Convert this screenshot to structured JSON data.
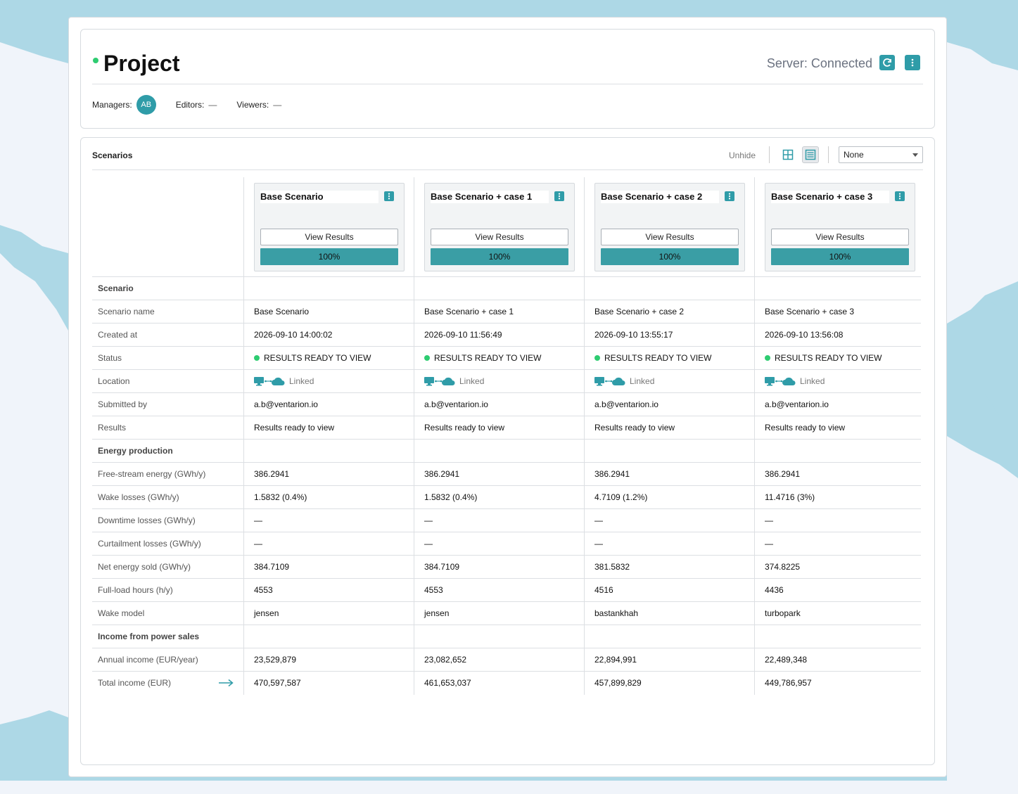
{
  "project": {
    "title": "Project",
    "server_status": "Server: Connected",
    "managers_label": "Managers:",
    "manager_initials": "AB",
    "editors_label": "Editors:",
    "editors_value": "—",
    "viewers_label": "Viewers:",
    "viewers_value": "—"
  },
  "scenarios_panel": {
    "title": "Scenarios",
    "unhide_label": "Unhide",
    "sort_select_value": "None"
  },
  "scenario_cards": [
    {
      "name": "Base Scenario",
      "button_label": "View Results",
      "progress_label": "100%",
      "progress": 1.0
    },
    {
      "name": "Base Scenario + case 1",
      "button_label": "View Results",
      "progress_label": "100%",
      "progress": 1.0
    },
    {
      "name": "Base Scenario + case 2",
      "button_label": "View Results",
      "progress_label": "100%",
      "progress": 1.0
    },
    {
      "name": "Base Scenario + case 3",
      "button_label": "View Results",
      "progress_label": "100%",
      "progress": 1.0
    }
  ],
  "rows": [
    {
      "label": "Scenario",
      "section": true,
      "values": [
        "",
        "",
        "",
        ""
      ]
    },
    {
      "label": "Scenario name",
      "values": [
        "Base Scenario",
        "Base Scenario + case 1",
        "Base Scenario + case 2",
        "Base Scenario + case 3"
      ]
    },
    {
      "label": "Created at",
      "values": [
        "2026-09-10 14:00:02",
        "2026-09-10 11:56:49",
        "2026-09-10 13:55:17",
        "2026-09-10 13:56:08"
      ]
    },
    {
      "label": "Status",
      "type": "status",
      "values": [
        "RESULTS READY TO VIEW",
        "RESULTS READY TO VIEW",
        "RESULTS READY TO VIEW",
        "RESULTS READY TO VIEW"
      ]
    },
    {
      "label": "Location",
      "type": "location",
      "values": [
        "Linked",
        "Linked",
        "Linked",
        "Linked"
      ]
    },
    {
      "label": "Submitted by",
      "values": [
        "a.b@ventarion.io",
        "a.b@ventarion.io",
        "a.b@ventarion.io",
        "a.b@ventarion.io"
      ]
    },
    {
      "label": "Results",
      "values": [
        "Results ready to view",
        "Results ready to view",
        "Results ready to view",
        "Results ready to view"
      ]
    },
    {
      "label": "Energy production",
      "section": true,
      "values": [
        "",
        "",
        "",
        ""
      ]
    },
    {
      "label": "Free-stream energy (GWh/y)",
      "values": [
        "386.2941",
        "386.2941",
        "386.2941",
        "386.2941"
      ]
    },
    {
      "label": "Wake losses (GWh/y)",
      "values": [
        "1.5832 (0.4%)",
        "1.5832 (0.4%)",
        "4.7109 (1.2%)",
        "11.4716 (3%)"
      ]
    },
    {
      "label": "Downtime losses (GWh/y)",
      "values": [
        "—",
        "—",
        "—",
        "—"
      ]
    },
    {
      "label": "Curtailment losses (GWh/y)",
      "values": [
        "—",
        "—",
        "—",
        "—"
      ]
    },
    {
      "label": "Net energy sold (GWh/y)",
      "values": [
        "384.7109",
        "384.7109",
        "381.5832",
        "374.8225"
      ]
    },
    {
      "label": "Full-load hours (h/y)",
      "values": [
        "4553",
        "4553",
        "4516",
        "4436"
      ]
    },
    {
      "label": "Wake model",
      "values": [
        "jensen",
        "jensen",
        "bastankhah",
        "turbopark"
      ]
    },
    {
      "label": "Income from power sales",
      "section": true,
      "values": [
        "",
        "",
        "",
        ""
      ]
    },
    {
      "label": "Annual income (EUR/year)",
      "values": [
        "23,529,879",
        "23,082,652",
        "22,894,991",
        "22,489,348"
      ]
    },
    {
      "label": "Total income (EUR)",
      "type": "total",
      "values": [
        "470,597,587",
        "461,653,037",
        "457,899,829",
        "449,786,957"
      ]
    }
  ],
  "colors": {
    "accent": "#2f9ca8",
    "progress_fill": "#3a9ea5",
    "status_green": "#2ecc71",
    "map_sea": "#add8e6",
    "map_land": "#f0f4fa"
  },
  "icons": {
    "refresh": "refresh-icon",
    "more": "vertical-dots-icon",
    "grid_view": "grid-view-icon",
    "list_view": "list-view-icon",
    "location": "computer-cloud-link-icon",
    "expand": "arrow-right-icon"
  }
}
